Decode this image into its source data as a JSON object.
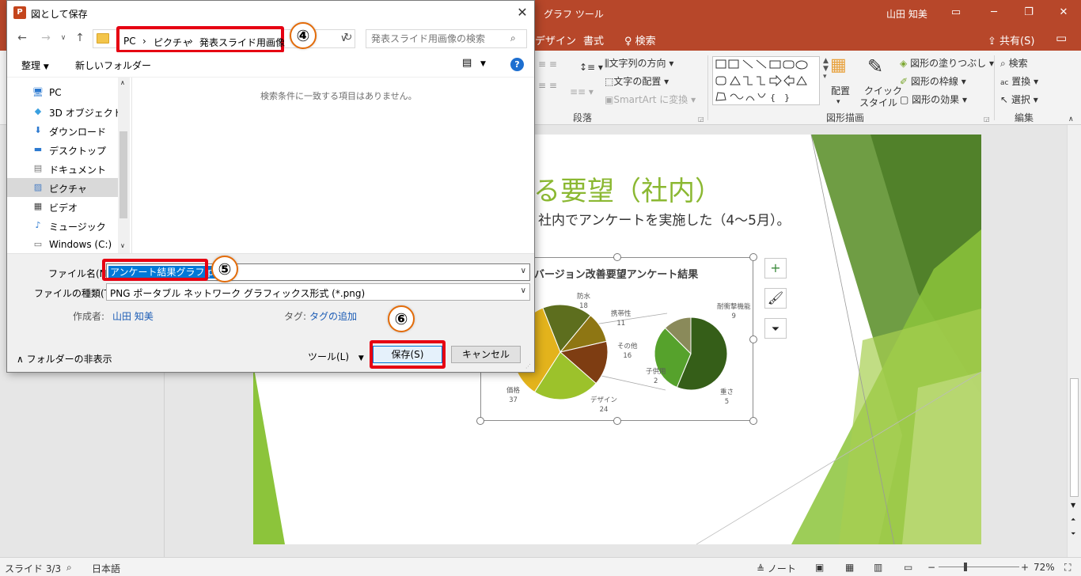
{
  "powerpoint": {
    "context_tab": "グラフ ツール",
    "user": "山田 知美",
    "ribbon_tabs": [
      "デザイン",
      "書式"
    ],
    "tell_me": "検索",
    "share": "共有(S)",
    "ribbon": {
      "paragraph_items": [
        "文字列の方向",
        "文字の配置",
        "SmartArt に変換"
      ],
      "paragraph_group": "段落",
      "arrange": "配置",
      "quick_style": [
        "クイック",
        "スタイル"
      ],
      "shape_items": [
        "図形の塗りつぶし",
        "図形の枠線",
        "図形の効果"
      ],
      "drawing_group": "図形描画",
      "edit_items": [
        "検索",
        "置換",
        "選択"
      ],
      "edit_group": "編集"
    },
    "slide": {
      "title": "する要望（社内）",
      "body": "社内でアンケートを実施した（4〜5月）。"
    },
    "status": {
      "slide": "スライド 3/3",
      "language": "日本語",
      "notes": "ノート",
      "zoom": "72%"
    }
  },
  "chart_data": {
    "type": "pie",
    "title": "バージョン改善要望アンケート結果",
    "series": [
      {
        "name": "",
        "categories": [
          "防水",
          "携帯性",
          "その他",
          "デザイン",
          "価格"
        ],
        "values": [
          18,
          11,
          16,
          24,
          37
        ],
        "colors": [
          "#5d6e1e",
          "#8e7613",
          "#7e3d12",
          "#9cc22b",
          "#e3b31c"
        ]
      },
      {
        "name": "",
        "categories": [
          "耐衝撃機能",
          "重さ",
          "子供用"
        ],
        "values": [
          9,
          5,
          2
        ],
        "colors": [
          "#355e18",
          "#56a22c",
          "#8a8a5a"
        ]
      }
    ]
  },
  "dialog": {
    "title": "図として保存",
    "breadcrumb": [
      "PC",
      "ピクチャ",
      "発表スライド用画像"
    ],
    "search_placeholder": "発表スライド用画像の検索",
    "organize": "整理",
    "new_folder": "新しいフォルダー",
    "nav_items": [
      "PC",
      "3D オブジェクト",
      "ダウンロード",
      "デスクトップ",
      "ドキュメント",
      "ピクチャ",
      "ビデオ",
      "ミュージック",
      "Windows (C:)"
    ],
    "empty_message": "検索条件に一致する項目はありません。",
    "filename_label": "ファイル名(N):",
    "filename_value": "アンケート結果グラフ.png",
    "filetype_label": "ファイルの種類(T):",
    "filetype_value": "PNG ポータブル ネットワーク グラフィックス形式 (*.png)",
    "author_label": "作成者:",
    "author_value": "山田 知美",
    "tags_label": "タグ:",
    "tags_value": "タグの追加",
    "hide_folders": "フォルダーの非表示",
    "tools": "ツール(L)",
    "save": "保存(S)",
    "cancel": "キャンセル"
  },
  "annotations": [
    "④",
    "⑤",
    "⑥"
  ]
}
